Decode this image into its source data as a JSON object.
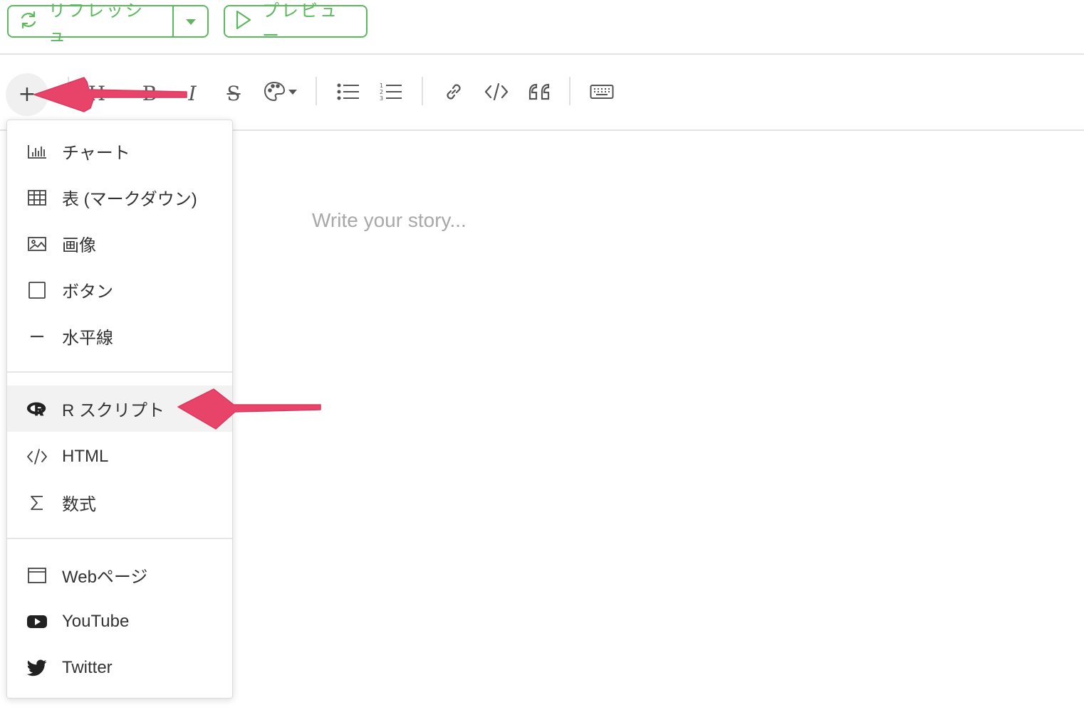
{
  "header": {
    "refresh_label": "リフレッシュ",
    "preview_label": "プレビュー",
    "accent": "#5cb85c"
  },
  "toolbar": {
    "add_label": "+",
    "heading_label": "H",
    "bold_label": "B",
    "italic_label": "I",
    "strike_label": "S"
  },
  "editor": {
    "placeholder": "Write your story..."
  },
  "insert_menu": {
    "items": [
      {
        "label": "チャート",
        "icon": "bar-chart-icon"
      },
      {
        "label": "表 (マークダウン)",
        "icon": "table-icon"
      },
      {
        "label": "画像",
        "icon": "image-icon"
      },
      {
        "label": "ボタン",
        "icon": "button-square-icon"
      },
      {
        "label": "水平線",
        "icon": "horizontal-rule-icon"
      },
      {
        "label": "R スクリプト",
        "icon": "r-logo-icon",
        "highlighted": true
      },
      {
        "label": "HTML",
        "icon": "code-icon"
      },
      {
        "label": "数式",
        "icon": "sigma-icon"
      },
      {
        "label": "Webページ",
        "icon": "browser-window-icon"
      },
      {
        "label": "YouTube",
        "icon": "youtube-icon"
      },
      {
        "label": "Twitter",
        "icon": "twitter-icon"
      }
    ]
  },
  "annotations": {
    "arrow_color": "#e8446a"
  }
}
